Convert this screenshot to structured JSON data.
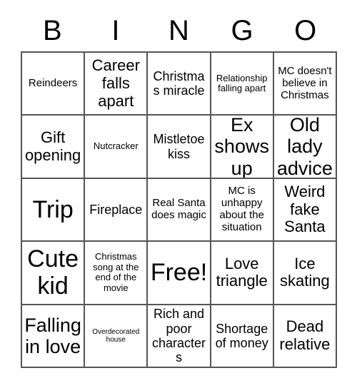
{
  "card": {
    "header": {
      "letters": [
        "B",
        "I",
        "N",
        "G",
        "O"
      ]
    },
    "rows": [
      [
        {
          "text": "Reindeers",
          "size": "sm"
        },
        {
          "text": "Career falls apart",
          "size": "lg"
        },
        {
          "text": "Christmas miracle",
          "size": "md"
        },
        {
          "text": "Relationship falling apart",
          "size": "xs"
        },
        {
          "text": "MC doesn't believe in Christmas",
          "size": "sm"
        }
      ],
      [
        {
          "text": "Gift opening",
          "size": "lg"
        },
        {
          "text": "Nutcracker",
          "size": "xs"
        },
        {
          "text": "Mistletoe kiss",
          "size": "md"
        },
        {
          "text": "Ex shows up",
          "size": "xl"
        },
        {
          "text": "Old lady advice",
          "size": "xl"
        }
      ],
      [
        {
          "text": "Trip",
          "size": "xxl"
        },
        {
          "text": "Fireplace",
          "size": "md"
        },
        {
          "text": "Real Santa does magic",
          "size": "sm"
        },
        {
          "text": "MC is unhappy about the situation",
          "size": "sm"
        },
        {
          "text": "Weird fake Santa",
          "size": "lg"
        }
      ],
      [
        {
          "text": "Cute kid",
          "size": "xxl"
        },
        {
          "text": "Christmas song at the end of the movie",
          "size": "xs"
        },
        {
          "text": "Free!",
          "size": "xxl"
        },
        {
          "text": "Love triangle",
          "size": "lg"
        },
        {
          "text": "Ice skating",
          "size": "lg"
        }
      ],
      [
        {
          "text": "Falling in love",
          "size": "xl"
        },
        {
          "text": "Overdecorated house",
          "size": "xxs"
        },
        {
          "text": "Rich and poor characters",
          "size": "md"
        },
        {
          "text": "Shortage of money",
          "size": "md"
        },
        {
          "text": "Dead relative",
          "size": "lg"
        }
      ]
    ],
    "colors": {
      "grid_line": "#555555",
      "text": "#000000",
      "background": "#ffffff"
    }
  }
}
